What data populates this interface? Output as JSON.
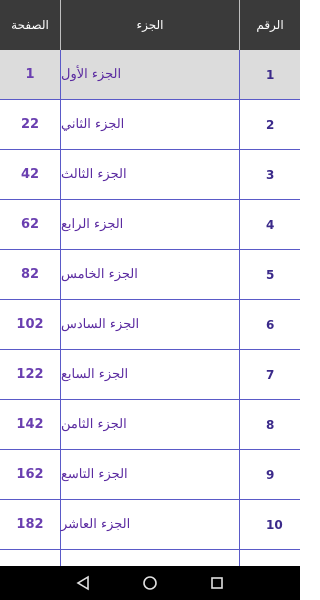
{
  "header": {
    "page_col": "الصفحة",
    "juz_col": "الجزء",
    "num_col": "الرقم"
  },
  "rows": [
    {
      "page": "1",
      "juz": "الجزء الأول",
      "num": "1"
    },
    {
      "page": "22",
      "juz": "الجزء الثاني",
      "num": "2"
    },
    {
      "page": "42",
      "juz": "الجزء الثالث",
      "num": "3"
    },
    {
      "page": "62",
      "juz": "الجزء الرابع",
      "num": "4"
    },
    {
      "page": "82",
      "juz": "الجزء الخامس",
      "num": "5"
    },
    {
      "page": "102",
      "juz": "الجزء السادس",
      "num": "6"
    },
    {
      "page": "122",
      "juz": "الجزء السابع",
      "num": "7"
    },
    {
      "page": "142",
      "juz": "الجزء الثامن",
      "num": "8"
    },
    {
      "page": "162",
      "juz": "الجزء التاسع",
      "num": "9"
    },
    {
      "page": "182",
      "juz": "الجزء العاشر",
      "num": "10"
    },
    {
      "page": "",
      "juz": "",
      "num": ""
    }
  ],
  "navbar": {
    "icons": [
      "back-icon",
      "home-icon",
      "recents-icon"
    ]
  }
}
